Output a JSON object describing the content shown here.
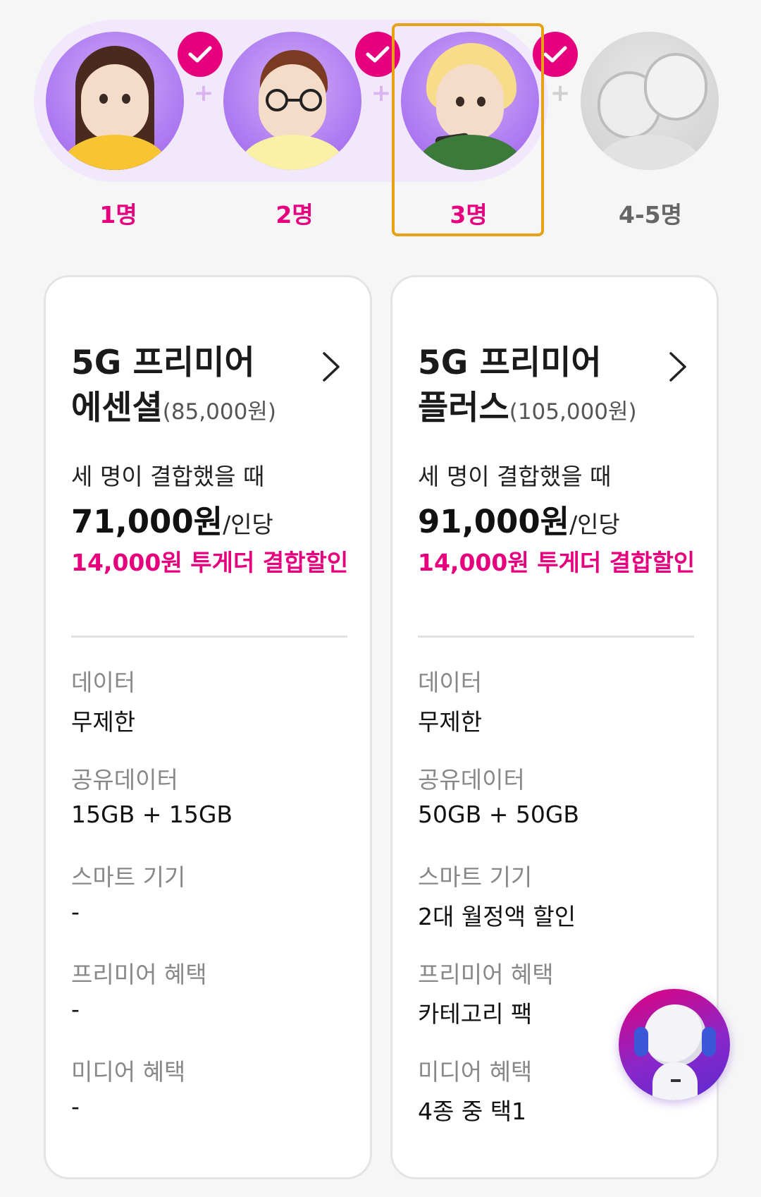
{
  "selector": {
    "options": [
      {
        "label": "1명",
        "checked": true
      },
      {
        "label": "2명",
        "checked": true
      },
      {
        "label": "3명",
        "checked": true
      },
      {
        "label": "4-5명",
        "checked": false
      }
    ],
    "selected": "3명"
  },
  "plans": [
    {
      "name_line1": "5G 프리미어",
      "name_line2": "에센셜",
      "price": "(85,000원)",
      "combo_text": "세 명이 결합했을 때",
      "per_person_price": "71,000원",
      "per_person_unit": "/인당",
      "discount": "14,000원 투게더 결합할인",
      "specs": [
        {
          "label": "데이터",
          "value": "무제한"
        },
        {
          "label": "공유데이터",
          "value": "15GB + 15GB"
        },
        {
          "label": "스마트 기기",
          "value": "-"
        },
        {
          "label": "프리미어 혜택",
          "value": "-"
        },
        {
          "label": "미디어 혜택",
          "value": "-"
        }
      ]
    },
    {
      "name_line1": "5G 프리미어",
      "name_line2": "플러스",
      "price": "(105,000원)",
      "combo_text": "세 명이 결합했을 때",
      "per_person_price": "91,000원",
      "per_person_unit": "/인당",
      "discount": "14,000원 투게더 결합할인",
      "specs": [
        {
          "label": "데이터",
          "value": "무제한"
        },
        {
          "label": "공유데이터",
          "value": "50GB + 50GB"
        },
        {
          "label": "스마트 기기",
          "value": "2대 월정액 할인"
        },
        {
          "label": "프리미어 혜택",
          "value": "카테고리 팩"
        },
        {
          "label": "미디어 혜택",
          "value": "4종 중 택1"
        }
      ]
    }
  ],
  "colors": {
    "accent": "#e6007e",
    "selection_border": "#e8a115",
    "avatar_purple": "#b07ef2"
  },
  "icons": {
    "check": "check-icon",
    "plus": "plus-icon",
    "chevron": "chevron-right-icon",
    "chatbot": "chatbot-icon"
  }
}
